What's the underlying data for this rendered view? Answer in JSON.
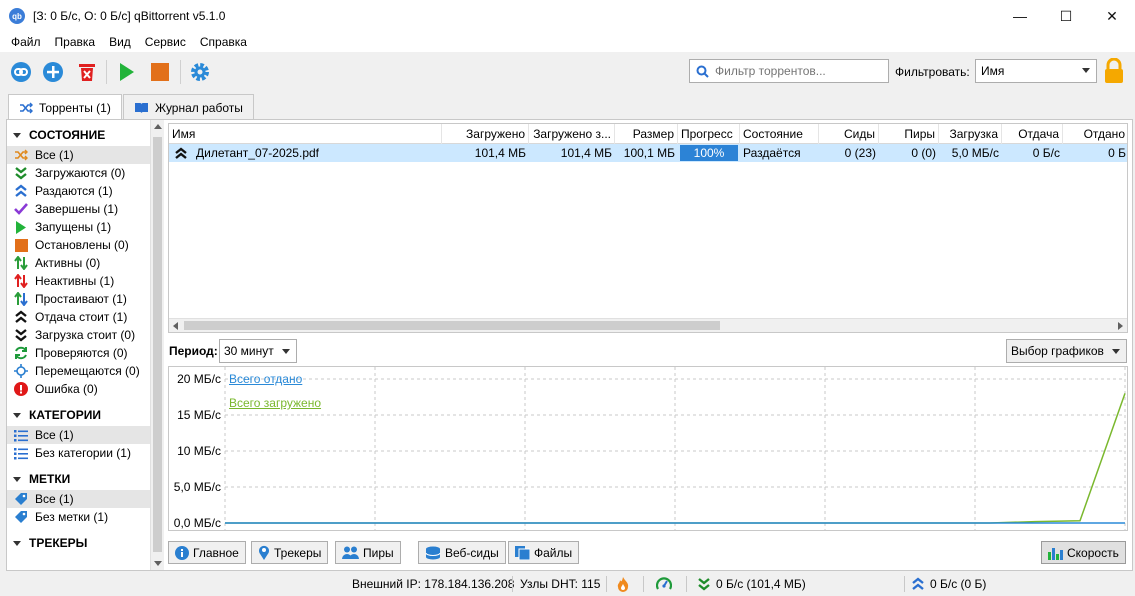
{
  "window": {
    "title": "[З: 0 Б/с, О: 0 Б/с] qBittorrent v5.1.0",
    "app_icon_text": "qb",
    "minimize": "—",
    "maximize": "☐",
    "close": "✕"
  },
  "menu": [
    "Файл",
    "Правка",
    "Вид",
    "Сервис",
    "Справка"
  ],
  "toolbar": {
    "buttons": [
      "link-icon",
      "add-icon",
      "delete-icon",
      "start-icon",
      "stop-icon",
      "settings-icon"
    ],
    "search_placeholder": "Фильтр торрентов...",
    "filter_label": "Фильтровать:",
    "filter_value": "Имя"
  },
  "tabs": [
    {
      "label": "Торренты (1)",
      "icon": "shuffle-icon",
      "active": true
    },
    {
      "label": "Журнал работы",
      "icon": "book-icon",
      "active": false
    }
  ],
  "sidebar": {
    "status_header": "СОСТОЯНИЕ",
    "status_items": [
      {
        "label": "Все (1)",
        "icon": "shuffle-icon",
        "color": "#e08a1e",
        "selected": true
      },
      {
        "label": "Загружаются (0)",
        "icon": "double-down-icon",
        "color": "#1e8c2a"
      },
      {
        "label": "Раздаются (1)",
        "icon": "double-up-icon",
        "color": "#2a6fd0"
      },
      {
        "label": "Завершены (1)",
        "icon": "check-icon",
        "color": "#8a3ad6"
      },
      {
        "label": "Запущены (1)",
        "icon": "play-icon",
        "color": "#22b33a"
      },
      {
        "label": "Остановлены (0)",
        "icon": "stop-icon",
        "color": "#e2701a"
      },
      {
        "label": "Активны (0)",
        "icon": "updown-active-icon",
        "color": "#2a9d3a"
      },
      {
        "label": "Неактивны (1)",
        "icon": "updown-inactive-icon",
        "color": "#e02020"
      },
      {
        "label": "Простаивают (1)",
        "icon": "updown-stalled-icon",
        "color": "#2a9d3a"
      },
      {
        "label": "Отдача стоит (1)",
        "icon": "double-up-black-icon",
        "color": "#111111"
      },
      {
        "label": "Загрузка стоит (0)",
        "icon": "double-down-black-icon",
        "color": "#111111"
      },
      {
        "label": "Проверяются (0)",
        "icon": "refresh-icon",
        "color": "#1e9a3a"
      },
      {
        "label": "Перемещаются (0)",
        "icon": "move-icon",
        "color": "#2a7fd0"
      },
      {
        "label": "Ошибка (0)",
        "icon": "error-icon",
        "color": "#e01818"
      }
    ],
    "categories_header": "КАТЕГОРИИ",
    "category_items": [
      {
        "label": "Все (1)",
        "icon": "list-icon",
        "selected": true
      },
      {
        "label": "Без категории (1)",
        "icon": "list-icon"
      }
    ],
    "tags_header": "МЕТКИ",
    "tag_items": [
      {
        "label": "Все (1)",
        "icon": "tag-icon",
        "selected": true
      },
      {
        "label": "Без метки (1)",
        "icon": "tag-icon"
      }
    ],
    "trackers_header": "ТРЕКЕРЫ"
  },
  "table": {
    "columns": [
      "Имя",
      "Загружено",
      "Загружено з...",
      "Размер",
      "Прогресс",
      "Состояние",
      "Сиды",
      "Пиры",
      "Загрузка",
      "Отдача",
      "Отдано"
    ],
    "rows": [
      {
        "name": "Дилетант_07-2025.pdf",
        "downloaded": "101,4 МБ",
        "downloaded_session": "101,4 МБ",
        "size": "100,1 МБ",
        "progress": "100%",
        "progress_value": 1.0,
        "state": "Раздаётся",
        "seeds": "0 (23)",
        "peers": "0 (0)",
        "dl_speed": "5,0 МБ/с",
        "up_speed": "0 Б/с",
        "uploaded": "0 Б"
      }
    ]
  },
  "graph": {
    "period_label": "Период:",
    "period_value": "30 минут",
    "graphs_select": "Выбор графиков",
    "y_ticks": [
      "20 МБ/с",
      "15 МБ/с",
      "10 МБ/с",
      "5,0 МБ/с",
      "0,0 МБ/с"
    ],
    "legend": [
      {
        "label": "Всего отдано",
        "color": "#2a8ad8"
      },
      {
        "label": "Всего загружено",
        "color": "#7ab82e"
      }
    ]
  },
  "chart_data": {
    "type": "line",
    "ylim": [
      0,
      20
    ],
    "series": [
      {
        "name": "Всего загружено",
        "values": [
          0,
          0,
          0,
          0,
          0,
          0,
          0,
          0,
          0,
          0,
          0,
          0,
          0,
          0,
          0,
          0,
          0,
          0,
          0.2,
          0.3,
          18
        ]
      },
      {
        "name": "Всего отдано",
        "values": [
          0,
          0,
          0,
          0,
          0,
          0,
          0,
          0,
          0,
          0,
          0,
          0,
          0,
          0,
          0,
          0,
          0,
          0,
          0,
          0,
          0
        ]
      }
    ]
  },
  "bottom_tabs": [
    {
      "label": "Главное",
      "icon": "info-icon"
    },
    {
      "label": "Трекеры",
      "icon": "pin-icon"
    },
    {
      "label": "Пиры",
      "icon": "peers-icon"
    },
    {
      "label": "Веб-сиды",
      "icon": "server-icon"
    },
    {
      "label": "Файлы",
      "icon": "files-icon"
    }
  ],
  "speed_button": "Скорость",
  "status": {
    "external_ip": "Внешний IP: 178.184.136.208",
    "dht": "Узлы DHT: 115",
    "download": "0 Б/с (101,4 МБ)",
    "upload": "0 Б/с (0 Б)"
  }
}
